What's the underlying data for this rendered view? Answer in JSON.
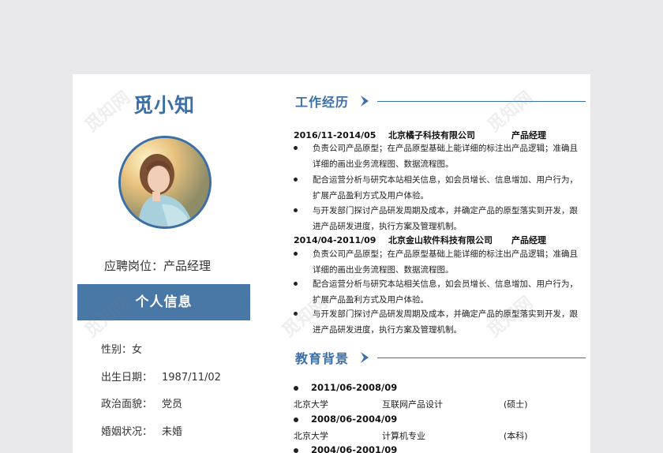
{
  "resume": {
    "name": "觅小知",
    "position_label": "应聘岗位：",
    "position_value": "产品经理"
  },
  "personal": {
    "title": "个人信息",
    "rows": [
      {
        "label": "性别：",
        "value": "女"
      },
      {
        "label": "出生日期：",
        "value": "1987/11/02"
      },
      {
        "label": "政治面貌：",
        "value": "党员"
      },
      {
        "label": "婚姻状况：",
        "value": "未婚"
      }
    ]
  },
  "work": {
    "title": "工作经历",
    "jobs": [
      {
        "date": "2016/11-2014/05",
        "company": "北京橘子科技有限公司",
        "role": "产品经理",
        "bullets": [
          "负责公司产品原型；在产品原型基础上能详细的标注出产品逻辑；准确且详细的画出业务流程图、数据流程图。",
          "配合运营分析与研究本站相关信息，如会员增长、信息增加、用户行为，扩展产品盈利方式及用户体验。",
          "与开发部门探讨产品研发周期及成本，并确定产品的原型落实到开发，跟进产品研发进度，执行方案及管理机制。"
        ]
      },
      {
        "date": "2014/04-2011/09",
        "company": "北京金山软件科技有限公司",
        "role": "产品经理",
        "bullets": [
          "负责公司产品原型；在产品原型基础上能详细的标注出产品逻辑；准确且详细的画出业务流程图、数据流程图。",
          "配合运营分析与研究本站相关信息，如会员增长、信息增加、用户行为，扩展产品盈利方式及用户体验。",
          "与开发部门探讨产品研发周期及成本，并确定产品的原型落实到开发，跟进产品研发进度，执行方案及管理机制。"
        ]
      }
    ]
  },
  "education": {
    "title": "教育背景",
    "items": [
      {
        "date": "2011/06-2008/09",
        "school": "北京大学",
        "major": "互联网产品设计",
        "degree": "(硕士)"
      },
      {
        "date": "2008/06-2004/09",
        "school": "北京大学",
        "major": "计算机专业",
        "degree": "(本科)"
      },
      {
        "date": "2004/06-2001/09",
        "school": "",
        "major": "",
        "degree": ""
      }
    ]
  },
  "watermark": "觅知网",
  "colors": {
    "accent": "#3c6fa5",
    "bar": "#4a78a6",
    "background": "#e9e9eb"
  }
}
